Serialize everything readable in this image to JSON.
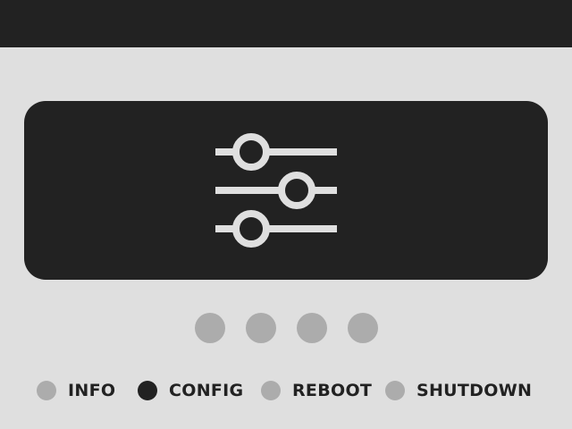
{
  "header": {
    "background": "#222222"
  },
  "panel": {
    "icon": "sliders-icon",
    "background": "#222222",
    "icon_color": "#dfdfdf"
  },
  "page_indicator": {
    "total": 4,
    "color": "#acacac"
  },
  "menu": {
    "selected": "CONFIG",
    "items": [
      {
        "label": "INFO"
      },
      {
        "label": "CONFIG"
      },
      {
        "label": "REBOOT"
      },
      {
        "label": "SHUTDOWN"
      }
    ]
  },
  "colors": {
    "background": "#dfdfdf",
    "dark": "#222222",
    "inactive": "#acacac"
  }
}
